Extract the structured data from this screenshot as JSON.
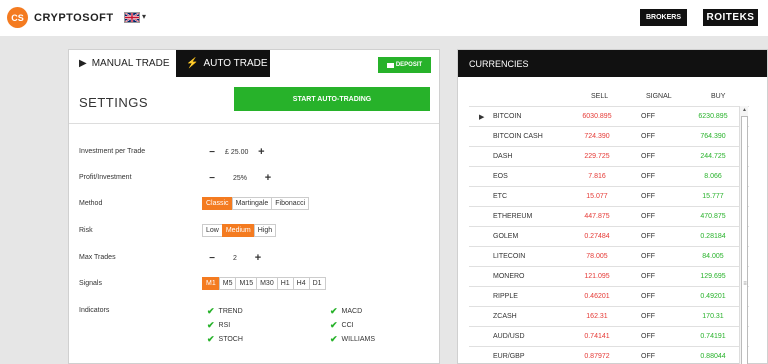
{
  "header": {
    "logo_badge": "CS",
    "logo_text": "CRYPTOSOFT",
    "brokers_label": "BROKERS",
    "partner_label": "ROITEKS"
  },
  "tabs": {
    "manual": "MANUAL TRADE",
    "auto": "AUTO TRADE"
  },
  "deposit_label": "DEPOSIT",
  "settings": {
    "title": "SETTINGS",
    "start_label": "START AUTO-TRADING",
    "investment_label": "Investment per Trade",
    "investment_value": "£ 25.00",
    "profit_label": "Profit/Investment",
    "profit_value": "25%",
    "method_label": "Method",
    "methods": [
      "Classic",
      "Martingale",
      "Fibonacci"
    ],
    "method_selected": "Classic",
    "risk_label": "Risk",
    "risks": [
      "Low",
      "Medium",
      "High"
    ],
    "risk_selected": "Medium",
    "max_trades_label": "Max Trades",
    "max_trades_value": "2",
    "signals_label": "Signals",
    "signals": [
      "M1",
      "M5",
      "M15",
      "M30",
      "H1",
      "H4",
      "D1"
    ],
    "signal_selected": "M1",
    "indicators_label": "Indicators",
    "indicators_left": [
      "TREND",
      "RSI",
      "STOCH"
    ],
    "indicators_right": [
      "MACD",
      "CCI",
      "WILLIAMS"
    ]
  },
  "currencies": {
    "title": "CURRENCIES",
    "columns": [
      "SELL",
      "SIGNAL",
      "BUY"
    ],
    "rows": [
      {
        "name": "BITCOIN",
        "sell": "6030.895",
        "signal": "OFF",
        "buy": "6230.895"
      },
      {
        "name": "BITCOIN CASH",
        "sell": "724.390",
        "signal": "OFF",
        "buy": "764.390"
      },
      {
        "name": "DASH",
        "sell": "229.725",
        "signal": "OFF",
        "buy": "244.725"
      },
      {
        "name": "EOS",
        "sell": "7.816",
        "signal": "OFF",
        "buy": "8.066"
      },
      {
        "name": "ETC",
        "sell": "15.077",
        "signal": "OFF",
        "buy": "15.777"
      },
      {
        "name": "ETHEREUM",
        "sell": "447.875",
        "signal": "OFF",
        "buy": "470.875"
      },
      {
        "name": "GOLEM",
        "sell": "0.27484",
        "signal": "OFF",
        "buy": "0.28184"
      },
      {
        "name": "LITECOIN",
        "sell": "78.005",
        "signal": "OFF",
        "buy": "84.005"
      },
      {
        "name": "MONERO",
        "sell": "121.095",
        "signal": "OFF",
        "buy": "129.695"
      },
      {
        "name": "RIPPLE",
        "sell": "0.46201",
        "signal": "OFF",
        "buy": "0.49201"
      },
      {
        "name": "ZCASH",
        "sell": "162.31",
        "signal": "OFF",
        "buy": "170.31"
      },
      {
        "name": "AUD/USD",
        "sell": "0.74141",
        "signal": "OFF",
        "buy": "0.74191"
      },
      {
        "name": "EUR/GBP",
        "sell": "0.87972",
        "signal": "OFF",
        "buy": "0.88044"
      }
    ],
    "selected_row": "BITCOIN"
  },
  "colors": {
    "accent_orange": "#f47b20",
    "green": "#27b22a",
    "red": "#e53935"
  }
}
